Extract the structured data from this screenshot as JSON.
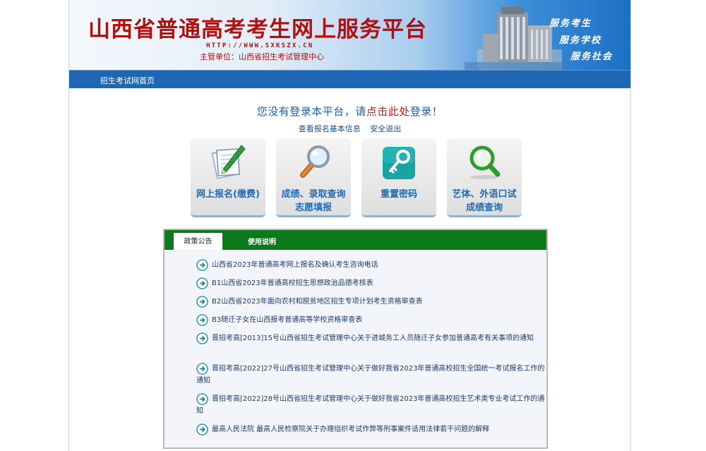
{
  "banner": {
    "title": "山西省普通高考考生网上服务平台",
    "url": "HTTP://WWW.SXKSZX.CN",
    "host": "主管单位：山西省招生考试管理中心",
    "slogans": [
      "服务考生",
      "服务学校",
      "服务社会"
    ]
  },
  "nav": {
    "home": "招生考试网首页"
  },
  "login": {
    "prefix": "您没有登录本平台，请",
    "link": "点击此处",
    "suffix": "登录！",
    "view_info": "查看报名基本信息",
    "logout": "安全退出"
  },
  "tiles": [
    {
      "icon": "pen-paper-icon",
      "label_lines": [
        "网上报名(缴费)",
        ""
      ]
    },
    {
      "icon": "magnifier-icon",
      "label_lines": [
        "成绩、录取查询",
        "志愿填报"
      ]
    },
    {
      "icon": "key-icon",
      "label_lines": [
        "重置密码",
        ""
      ]
    },
    {
      "icon": "green-magnifier-icon",
      "label_lines": [
        "艺体、外语口试",
        "成绩查询"
      ]
    }
  ],
  "panel": {
    "tabs": [
      "政策公告",
      "使用说明"
    ],
    "notices": [
      "山西省2023年普通高考网上报名及确认考生咨询电话",
      "B1山西省2023年普通高校招生思想政治品德考核表",
      "B2山西省2023年面向农村和脱贫地区招生专项计划考生资格审查表",
      "B3随迁子女在山西报考普通高等学校资格审查表",
      "晋招考高[2013]15号山西省招生考试管理中心关于进城务工人员随迁子女参加普通高考有关事项的通知",
      "晋招考高[2022]27号山西省招生考试管理中心关于做好我省2023年普通高校招生全国统一考试报名工作的通知",
      "晋招考高[2022]28号山西省招生考试管理中心关于做好我省2023年普通高校招生艺术类专业考试工作的通知",
      "最高人民法院 最高人民检察院关于办理组织考试作弊等刑事案件适用法律若干问题的解释"
    ]
  },
  "colors": {
    "banner_red": "#b01010",
    "nav_blue": "#1f67b5",
    "tab_green": "#0c7a1a",
    "tile_label_blue": "#1e6bb8",
    "link_red": "#d21414"
  }
}
